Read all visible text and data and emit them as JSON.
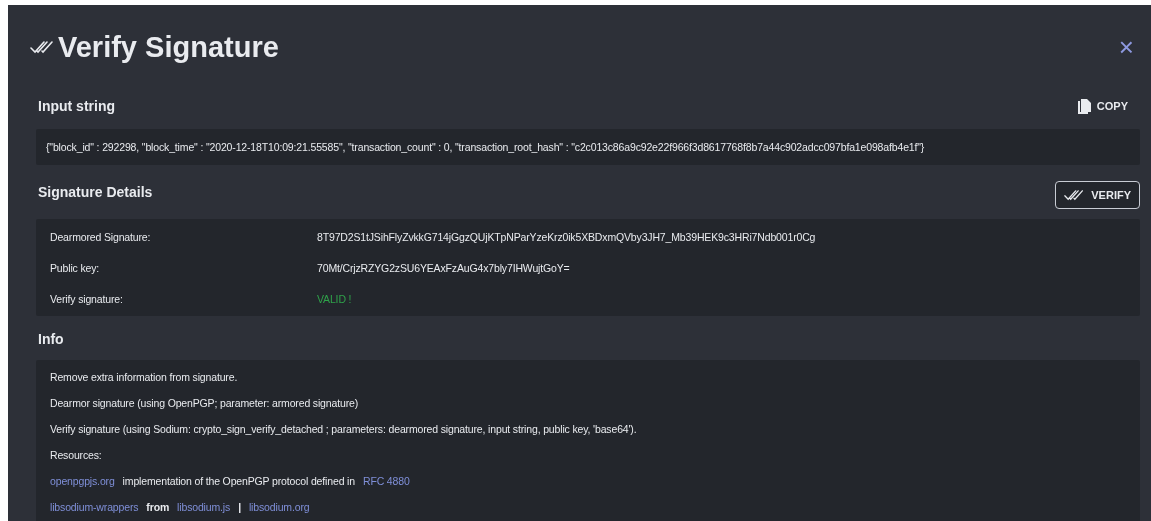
{
  "dialog": {
    "title": "Verify Signature",
    "close": "×"
  },
  "input_section": {
    "heading": "Input string",
    "copy_label": "COPY",
    "value": "{\"block_id\" : 292298, \"block_time\" : \"2020-12-18T10:09:21.55585\", \"transaction_count\" : 0, \"transaction_root_hash\" : \"c2c013c86a9c92e22f966f3d8617768f8b7a44c902adcc097bfa1e098afb4e1f\"}"
  },
  "signature_section": {
    "heading": "Signature Details",
    "verify_label": "VERIFY",
    "rows": [
      {
        "label": "Dearmored Signature:",
        "value": "8T97D2S1tJSihFlyZvkkG714jGgzQUjKTpNParYzeKrz0ik5XBDxmQVby3JH7_Mb39HEK9c3HRi7Ndb001r0Cg",
        "kind": "text"
      },
      {
        "label": "Public key:",
        "value": "70Mt/CrjzRZYG2zSU6YEAxFzAuG4x7bly7IHWujtGoY=",
        "kind": "text"
      },
      {
        "label": "Verify signature:",
        "value": "VALID !",
        "kind": "status"
      }
    ]
  },
  "info_section": {
    "heading": "Info",
    "lines": [
      "Remove extra information from signature.",
      "Dearmor signature (using OpenPGP; parameter: armored signature)",
      "Verify signature (using Sodium: crypto_sign_verify_detached ; parameters: dearmored signature, input string, public key, 'base64').",
      "Resources:"
    ],
    "resources": [
      [
        {
          "kind": "link",
          "text": "openpgpjs.org"
        },
        {
          "kind": "text",
          "text": "implementation of the OpenPGP protocol defined in"
        },
        {
          "kind": "link",
          "text": "RFC 4880"
        }
      ],
      [
        {
          "kind": "link",
          "text": "libsodium-wrappers"
        },
        {
          "kind": "bold",
          "text": "from"
        },
        {
          "kind": "link",
          "text": "libsodium.js"
        },
        {
          "kind": "bold",
          "text": "|"
        },
        {
          "kind": "link",
          "text": "libsodium.org"
        }
      ]
    ]
  }
}
